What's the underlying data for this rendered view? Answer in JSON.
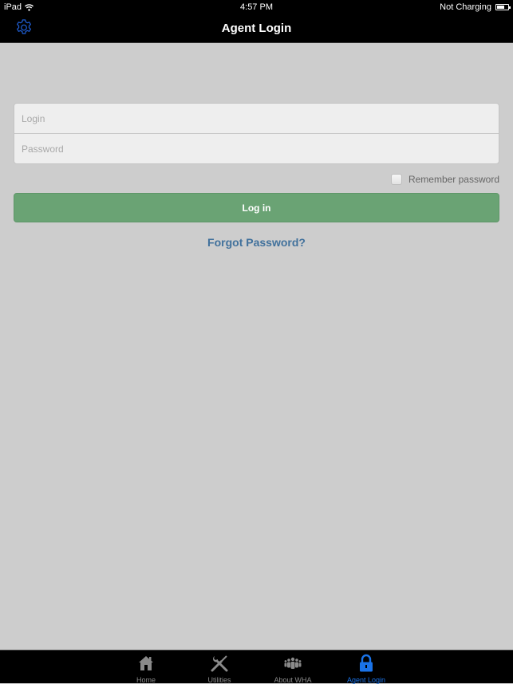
{
  "statusbar": {
    "device": "iPad",
    "time": "4:57 PM",
    "battery_status": "Not Charging",
    "icons": {
      "wifi": "wifi-icon",
      "battery": "battery-icon"
    }
  },
  "navbar": {
    "title": "Agent Login",
    "left_icon": "gear-icon"
  },
  "form": {
    "login": {
      "placeholder": "Login",
      "value": ""
    },
    "password": {
      "placeholder": "Password",
      "value": ""
    },
    "remember_label": "Remember password",
    "remember_checked": false,
    "login_button": "Log in",
    "forgot_link": "Forgot Password?"
  },
  "colors": {
    "accent": "#1a73e8",
    "login_button": "#6aa374",
    "link": "#41719c",
    "background": "#cdcdcd"
  },
  "tabbar": {
    "items": [
      {
        "label": "Home",
        "icon": "home-icon",
        "active": false
      },
      {
        "label": "Utilities",
        "icon": "tools-icon",
        "active": false
      },
      {
        "label": "About WHA",
        "icon": "people-icon",
        "active": false
      },
      {
        "label": "Agent Login",
        "icon": "lock-icon",
        "active": true
      }
    ]
  }
}
